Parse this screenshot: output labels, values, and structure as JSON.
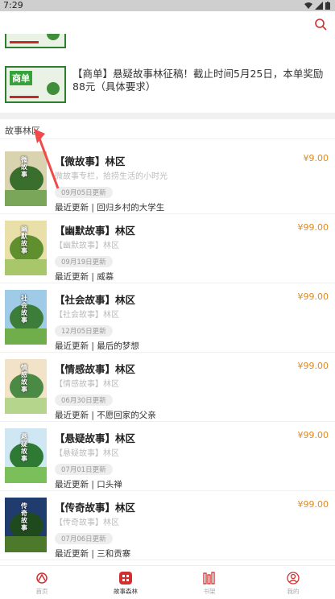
{
  "statusbar": {
    "time": "7:29"
  },
  "banner": {
    "thumb_label": "商单",
    "text": "【商单】悬疑故事林征稿！截止时间5月25日，本单奖励88元（具体要求）"
  },
  "section": {
    "title": "故事林区"
  },
  "items": [
    {
      "name": "【微故事】林区",
      "price": "¥9.00",
      "sub": "微故事专栏，拾捞生活的小时光",
      "date": "09月05日更新",
      "latest": "最近更新 | 回归乡村的大学生",
      "cover_title": "微故事",
      "cover_colors": [
        "#d9d3b0",
        "#3a6e2c",
        "#7aa65a"
      ]
    },
    {
      "name": "【幽默故事】林区",
      "price": "¥99.00",
      "sub": "【幽默故事】林区",
      "date": "09月19日更新",
      "latest": "最近更新 | 威慕",
      "cover_title": "幽默故事",
      "cover_colors": [
        "#e8e0a8",
        "#5f8f2e",
        "#a8c76a"
      ]
    },
    {
      "name": "【社会故事】林区",
      "price": "¥99.00",
      "sub": "【社会故事】林区",
      "date": "12月05日更新",
      "latest": "最近更新 | 最后的梦想",
      "cover_title": "社会故事",
      "cover_colors": [
        "#9fcbe6",
        "#3c7d3a",
        "#6fae4b"
      ]
    },
    {
      "name": "【情感故事】林区",
      "price": "¥99.00",
      "sub": "【情感故事】林区",
      "date": "06月30日更新",
      "latest": "最近更新 | 不愿回家的父亲",
      "cover_title": "情感故事",
      "cover_colors": [
        "#f2e2c8",
        "#4b8a45",
        "#b6d58c"
      ]
    },
    {
      "name": "【悬疑故事】林区",
      "price": "¥99.00",
      "sub": "【悬疑故事】林区",
      "date": "07月01日更新",
      "latest": "最近更新 | 口头禅",
      "cover_title": "悬疑故事",
      "cover_colors": [
        "#cfe7f3",
        "#2e7a35",
        "#7bbf5a"
      ]
    },
    {
      "name": "【传奇故事】林区",
      "price": "¥99.00",
      "sub": "【传奇故事】林区",
      "date": "07月06日更新",
      "latest": "最近更新 | 三和贡寨",
      "cover_title": "传奇故事",
      "cover_colors": [
        "#203c6e",
        "#1f4a1e",
        "#4d7a2a"
      ]
    }
  ],
  "tabs": [
    {
      "label": "首页",
      "icon": "home-icon",
      "active": false
    },
    {
      "label": "故事森林",
      "icon": "forest-icon",
      "active": true
    },
    {
      "label": "书架",
      "icon": "bookshelf-icon",
      "active": false
    },
    {
      "label": "我的",
      "icon": "profile-icon",
      "active": false
    }
  ],
  "colors": {
    "price": "#e08b22",
    "accent": "#d32f2f"
  }
}
